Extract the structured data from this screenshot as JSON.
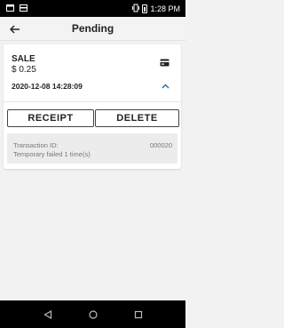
{
  "status_bar": {
    "time": "1:28 PM",
    "icons": [
      "notification-icon",
      "card-icon",
      "vibrate-icon",
      "battery-icon"
    ]
  },
  "app_bar": {
    "title": "Pending",
    "back_icon": "arrow-left-icon"
  },
  "transaction": {
    "type": "SALE",
    "amount": "$ 0.25",
    "datetime": "2020-12-08 14:28:09",
    "payment_icon": "credit-card-icon",
    "expand_icon": "chevron-up-icon",
    "actions": {
      "receipt_label": "RECEIPT",
      "delete_label": "DELETE"
    },
    "details": {
      "id_label": "Transaction ID:",
      "id_value": "000020",
      "status_text": "Temporary failed 1 time(s)"
    }
  },
  "nav_bar": {
    "icons": [
      "back-triangle-icon",
      "home-circle-icon",
      "recents-square-icon"
    ]
  },
  "colors": {
    "accent": "#1e6fb8",
    "status_bar_bg": "#000000",
    "nav_bar_bg": "#000000",
    "details_bg": "#ececec"
  }
}
